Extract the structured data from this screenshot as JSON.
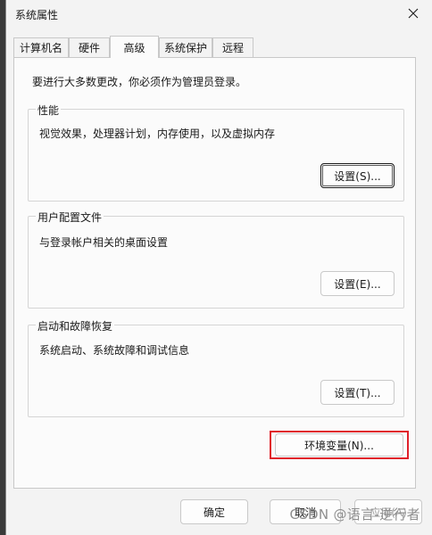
{
  "window": {
    "title": "系统属性"
  },
  "tabs": [
    {
      "label": "计算机名",
      "active": false
    },
    {
      "label": "硬件",
      "active": false
    },
    {
      "label": "高级",
      "active": true
    },
    {
      "label": "系统保护",
      "active": false
    },
    {
      "label": "远程",
      "active": false
    }
  ],
  "notice": "要进行大多数更改，你必须作为管理员登录。",
  "groups": {
    "performance": {
      "title": "性能",
      "desc": "视觉效果，处理器计划，内存使用，以及虚拟内存",
      "button": "设置(S)..."
    },
    "profile": {
      "title": "用户配置文件",
      "desc": "与登录帐户相关的桌面设置",
      "button": "设置(E)..."
    },
    "startup": {
      "title": "启动和故障恢复",
      "desc": "系统启动、系统故障和调试信息",
      "button": "设置(T)..."
    }
  },
  "env_button": "环境变量(N)...",
  "footer": {
    "ok": "确定",
    "cancel": "取消",
    "apply": "应用(A)"
  },
  "watermark": "CSDN @语言-逆行者",
  "colors": {
    "highlight": "#e0202a",
    "window_bg": "#f3f3f3"
  },
  "icons": {
    "close": "close-icon"
  }
}
